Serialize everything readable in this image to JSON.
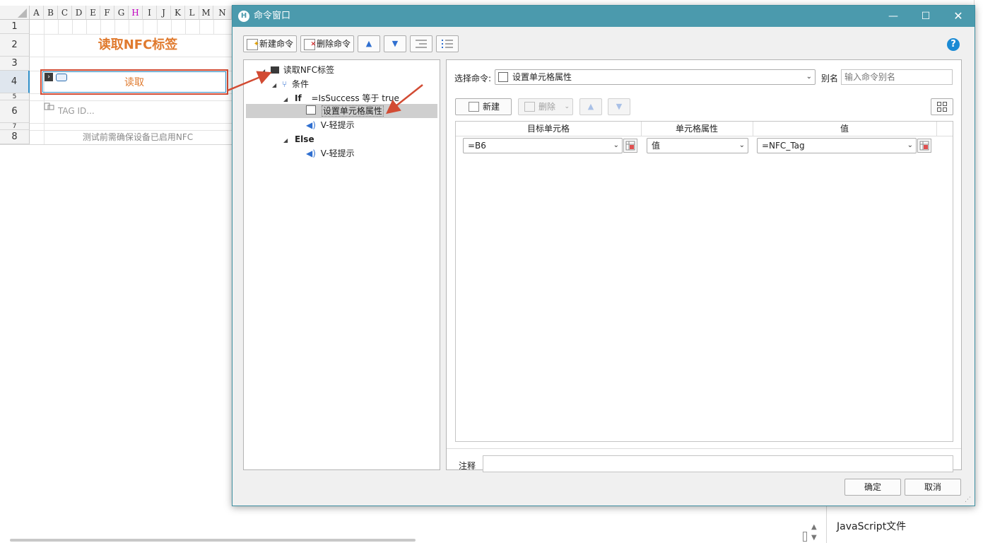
{
  "sheet": {
    "columns": [
      "A",
      "B",
      "C",
      "D",
      "E",
      "F",
      "G",
      "H",
      "I",
      "J",
      "K",
      "L",
      "M",
      "N"
    ],
    "rows": [
      "1",
      "2",
      "3",
      "4",
      "5",
      "6",
      "7",
      "8"
    ],
    "title_cell": "读取NFC标签",
    "read_button": "读取",
    "tag_placeholder": "TAG ID...",
    "note": "测试前需确保设备已启用NFC"
  },
  "dialog": {
    "title": "命令窗口",
    "toolbar": {
      "new_command": "新建命令",
      "delete_command": "删除命令"
    },
    "help": "?",
    "tree": {
      "root": "读取NFC标签",
      "condition": "条件",
      "if_keyword": "If",
      "if_expr": "=IsSuccess 等于 true",
      "set_cell": "设置单元格属性",
      "toast1": "V-轻提示",
      "else_keyword": "Else",
      "toast2": "V-轻提示"
    },
    "select_label": "选择命令:",
    "select_value": "设置单元格属性",
    "alias_label": "别名",
    "alias_placeholder": "输入命令别名",
    "grid_toolbar": {
      "new": "新建",
      "delete": "删除"
    },
    "table": {
      "headers": [
        "目标单元格",
        "单元格属性",
        "值"
      ],
      "row": {
        "target": "=B6",
        "property": "值",
        "value": "=NFC_Tag"
      }
    },
    "note_label": "注释",
    "ok": "确定",
    "cancel": "取消"
  },
  "background": {
    "js_file": "JavaScript文件"
  },
  "colors": {
    "title_bar": "#4b9aad",
    "accent_orange": "#e07a2e",
    "arrow_red": "#d24b33",
    "sheet_h_col": "#c000c0"
  }
}
